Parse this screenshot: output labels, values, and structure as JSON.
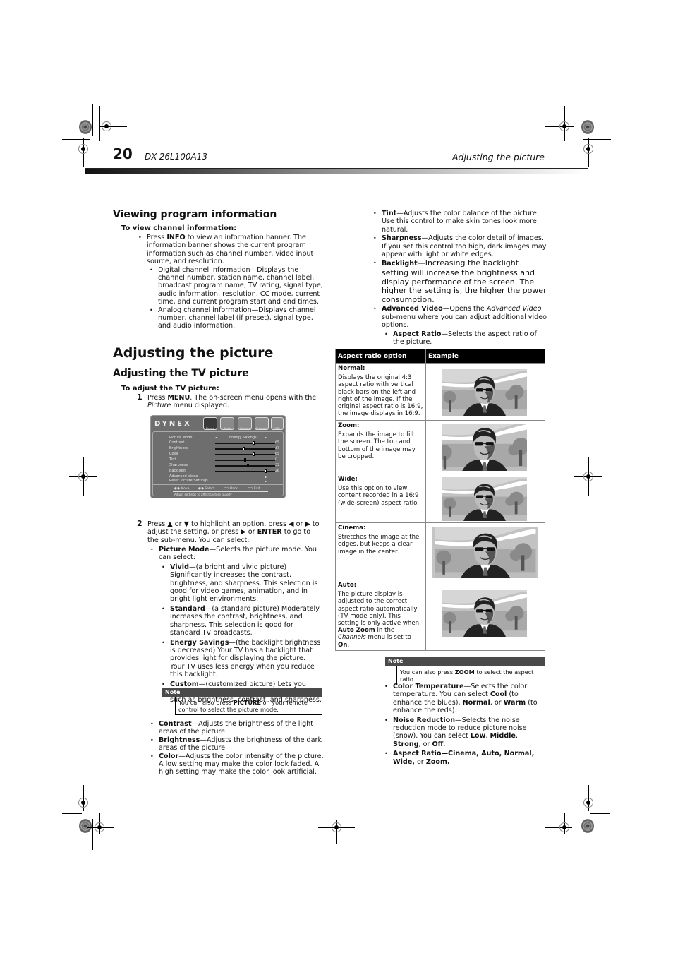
{
  "header": {
    "page_number": "20",
    "model": "DX-26L100A13",
    "section": "Adjusting the picture"
  },
  "viewing": {
    "title": "Viewing program information",
    "procedure": "To view channel information:",
    "info_pre": "Press ",
    "info_key": "INFO",
    "info_post": " to view an information banner. The information banner shows the current program information such as channel number, video input source, and resolution.",
    "digital": "Digital channel information—Displays the channel number, station name, channel label, broadcast program name, TV rating, signal type, audio information, resolution, CC mode, current time, and current program start and end times.",
    "analog": "Analog channel information—Displays channel number, channel label (if preset), signal type, and audio information."
  },
  "adjusting": {
    "title": "Adjusting the picture",
    "subtitle": "Adjusting the TV picture",
    "procedure": "To adjust the TV picture:",
    "step1_num": "1",
    "step1_pre": "Press ",
    "step1_key": "MENU",
    "step1_mid": ". The on-screen menu opens with the ",
    "step1_italic": "Picture",
    "step1_post": " menu displayed.",
    "step2_num": "2",
    "step2_a": "Press ▲ or ▼ to highlight an option, press ◀ or ▶ to adjust the setting, or press ▶ or ",
    "step2_key": "ENTER",
    "step2_b": " to go to the sub-menu. You can select:",
    "picture_mode_term": "Picture Mode",
    "picture_mode_desc": "—Selects the picture mode. You can select:",
    "modes": [
      {
        "term": "Vivid",
        "desc": "—(a bright and vivid picture) Significantly increases the contrast, brightness, and sharpness. This selection is good for video games, animation, and in bright light environments."
      },
      {
        "term": "Standard",
        "desc": "—(a standard picture) Moderately increases the contrast, brightness, and sharpness. This selection is good for standard TV broadcasts."
      },
      {
        "term": "Energy Savings",
        "desc": "—(the backlight brightness is decreased) Your TV has a backlight that provides light for displaying the picture. Your TV uses less energy when you reduce this backlight."
      },
      {
        "term": "Custom",
        "desc": "—(customized picture) Lets you manually customize the picture settings such as brightness, contrast, and sharpness."
      }
    ],
    "note1_label": "Note",
    "note1_pre": "You can also press ",
    "note1_key": "PICTURE",
    "note1_post": " on your remote control to select the picture mode.",
    "left_items": [
      {
        "term": "Contrast",
        "desc": "—Adjusts the brightness of the light areas of the picture."
      },
      {
        "term": "Brightness",
        "desc": "—Adjusts the brightness of the dark areas of the picture."
      },
      {
        "term": "Color",
        "desc": "—Adjusts the color intensity of the picture. A low setting may make the color look faded. A high setting may make the color look artificial."
      }
    ]
  },
  "osd": {
    "logo": "DYNEX",
    "tabs": [
      "Picture",
      "Audio",
      "Settings",
      "Channels",
      "USB"
    ],
    "picture_mode_label": "Picture Mode",
    "picture_mode_value": "Energy Savings",
    "sliders": [
      {
        "label": "Contrast",
        "value": "65",
        "level": 0.65
      },
      {
        "label": "Brightness",
        "value": "47",
        "level": 0.47
      },
      {
        "label": "Color",
        "value": "65",
        "level": 0.65
      },
      {
        "label": "Tint",
        "value": "0",
        "level": 0.5
      },
      {
        "label": "Sharpness",
        "value": "55",
        "level": 0.55
      },
      {
        "label": "Backlight",
        "value": "26",
        "level": 0.85
      }
    ],
    "advanced_video": "Advanced Video",
    "reset": "Reset Picture Settings",
    "nav_move": "Move",
    "nav_select": "Select",
    "nav_back": "Back",
    "nav_exit": "Exit",
    "hint": "Adjust settings to affect picture quality"
  },
  "right": {
    "items": [
      {
        "term": "Tint",
        "desc": "—Adjusts the color balance of the picture. Use this control to make skin tones look more natural."
      },
      {
        "term": "Sharpness",
        "desc": "—Adjusts the color detail of images. If you set this control too high, dark images may appear with light or white edges."
      }
    ],
    "backlight_term": "Backlight",
    "backlight_desc": "—Increasing the backlight setting will increase the brightness and display performance of the screen. The higher the setting is, the higher the power consumption.",
    "advanced_term": "Advanced Video",
    "advanced_pre": "—Opens the ",
    "advanced_italic": "Advanced Video",
    "advanced_post": " sub-menu where you can adjust additional video options.",
    "aspect_term": "Aspect Ratio",
    "aspect_desc": "—Selects the aspect ratio of the picture.",
    "table": {
      "col1": "Aspect ratio option",
      "col2": "Example",
      "rows": [
        {
          "name": "Normal:",
          "desc": "Displays the original 4:3 aspect ratio with vertical black bars on the left and right of the image. If the original aspect ratio is 16:9, the image displays in 16:9."
        },
        {
          "name": "Zoom:",
          "desc": "Expands the image to fill the screen. The top and bottom of the image may be cropped."
        },
        {
          "name": "Wide:",
          "desc": "Use this option to view content recorded in a 16:9 (wide-screen) aspect ratio."
        },
        {
          "name": "Cinema:",
          "desc": "Stretches the image at the edges, but keeps a clear image in the center."
        },
        {
          "name": "Auto:",
          "desc_a": "The picture display is adjusted to the correct aspect ratio automatically (TV mode only). This setting is only active when ",
          "desc_b1": "Auto Zoom",
          "desc_c": " in the ",
          "desc_i": "Channels",
          "desc_d": " menu is set to ",
          "desc_b2": "On",
          "desc_e": "."
        }
      ]
    },
    "note2_label": "Note",
    "note2_pre": "You can also press ",
    "note2_key": "ZOOM",
    "note2_post": " to select the aspect ratio.",
    "ct_term": "Color Temperature",
    "ct_a": "—Selects the color temperature. You can select ",
    "ct_cool": "Cool",
    "ct_b": " (to enhance the blues), ",
    "ct_normal": "Normal",
    "ct_c": ", or ",
    "ct_warm": "Warm",
    "ct_d": " (to enhance the reds).",
    "nr_term": "Noise Reduction",
    "nr_a": "—Selects the noise reduction mode to reduce picture noise (snow). You can select ",
    "nr_low": "Low",
    "nr_sep1": ", ",
    "nr_mid": "Middle",
    "nr_sep2": ", ",
    "nr_strong": "Strong",
    "nr_b": ", or ",
    "nr_off": "Off",
    "nr_c": ".",
    "ar_term": "Aspect Ratio",
    "ar_values": "—Cinema, Auto, Normal, Wide,",
    "ar_or": " or ",
    "ar_zoom": "Zoom."
  }
}
